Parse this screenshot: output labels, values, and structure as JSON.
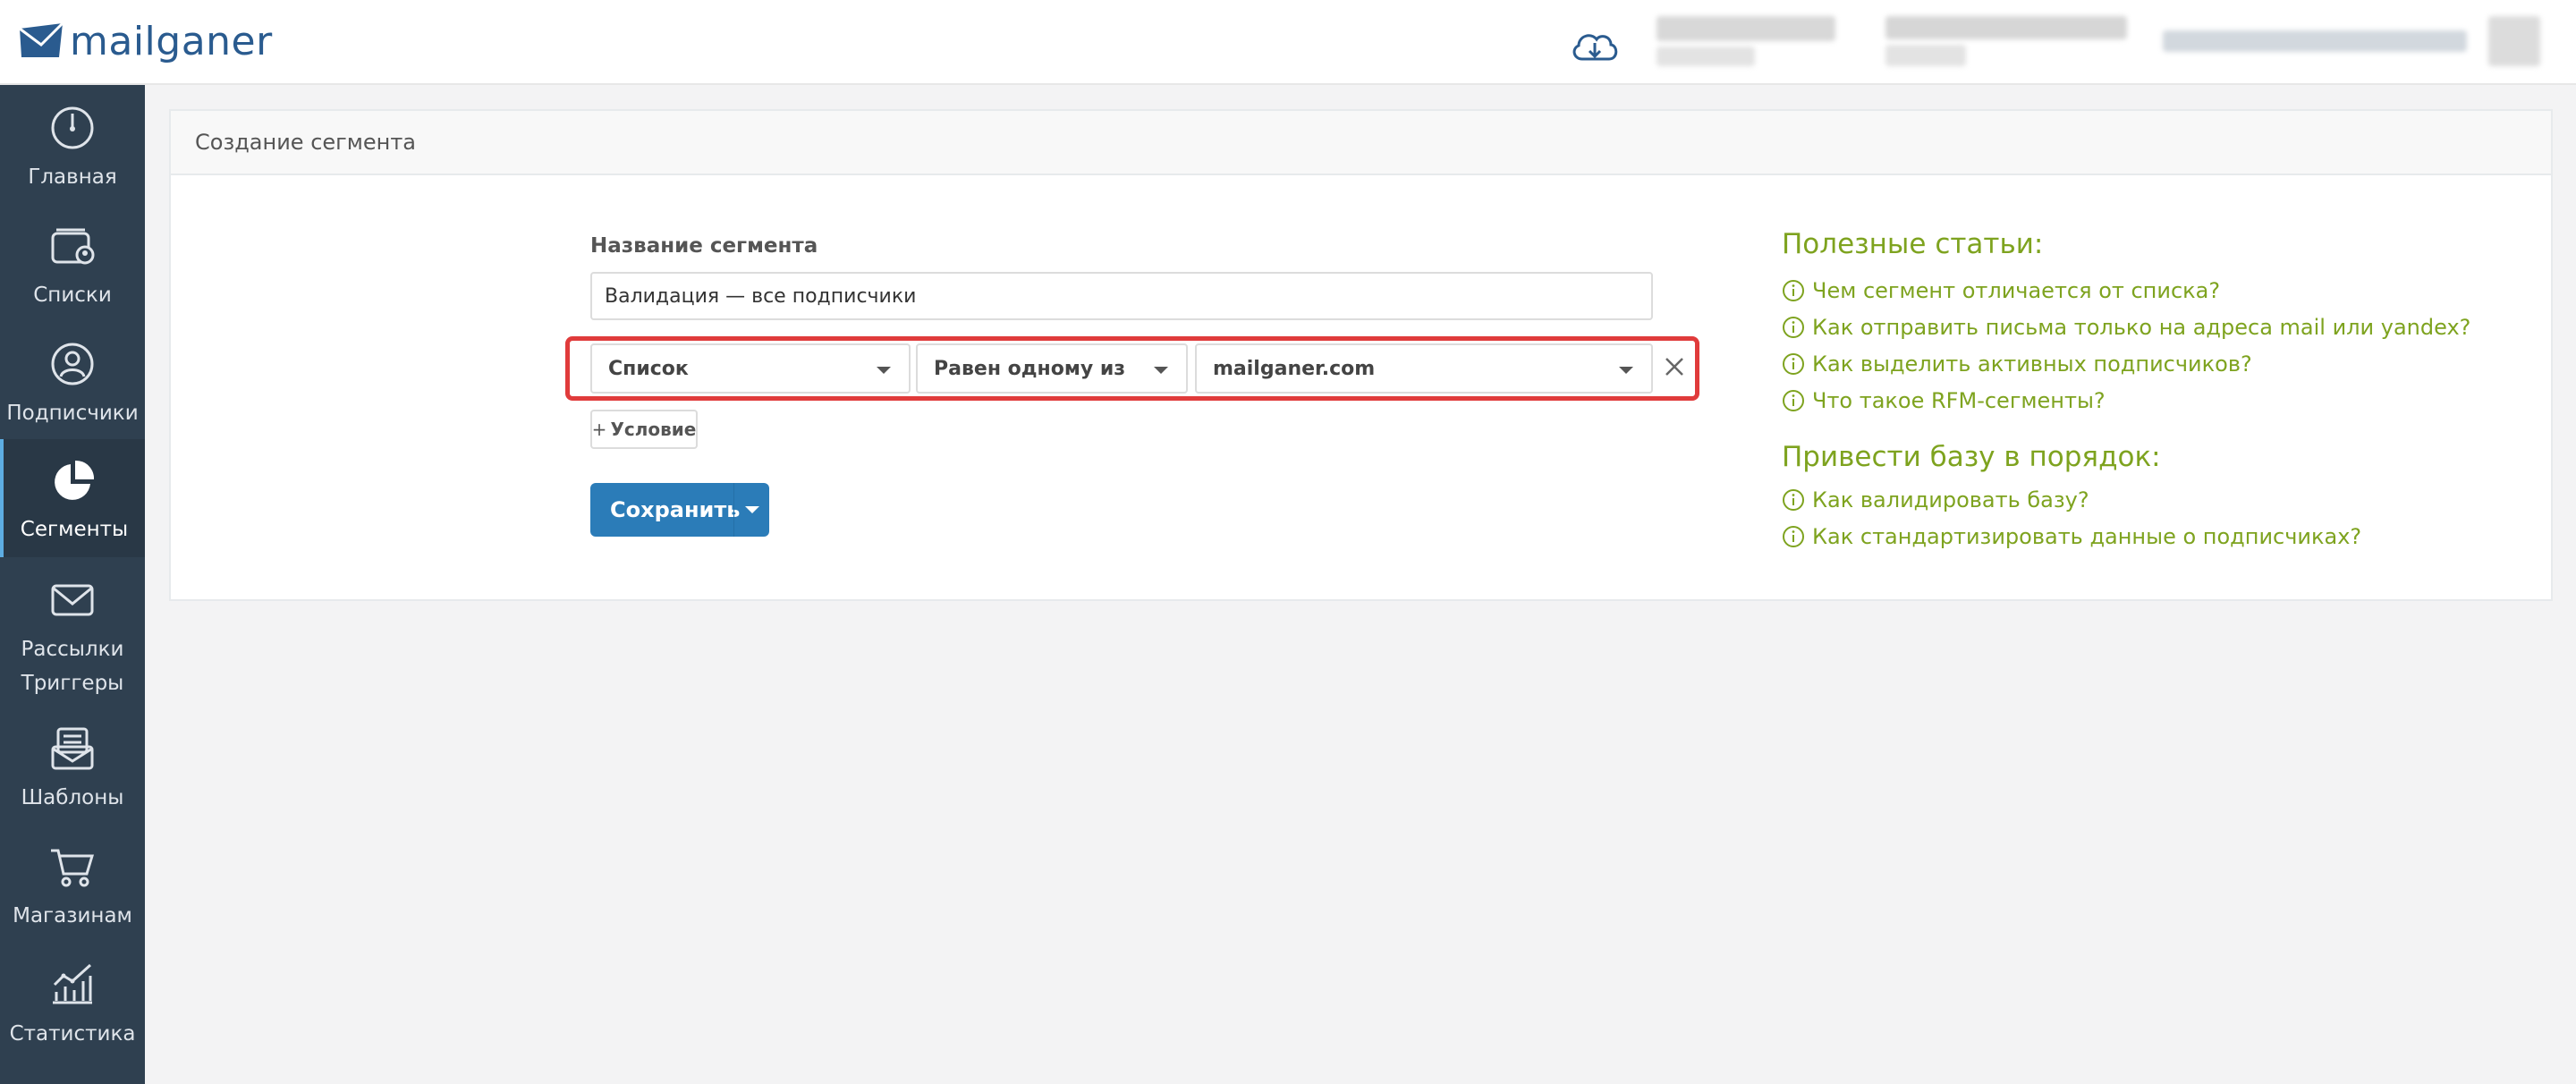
{
  "brand": {
    "name": "mailganer",
    "color": "#2a5b8f"
  },
  "header": {
    "cloud_icon": "cloud-download-icon",
    "user_info": "blurred"
  },
  "sidebar": {
    "items": [
      {
        "label": "Главная",
        "icon": "dashboard-icon"
      },
      {
        "label": "Списки",
        "icon": "lists-icon"
      },
      {
        "label": "Подписчики",
        "icon": "subscribers-icon"
      },
      {
        "label": "Сегменты",
        "icon": "segments-icon",
        "active": true
      },
      {
        "label": "Рассылки",
        "icon": "envelope-icon"
      },
      {
        "label": "Триггеры",
        "icon": "triggers-icon"
      },
      {
        "label": "Шаблоны",
        "icon": "templates-icon"
      },
      {
        "label": "Магазинам",
        "icon": "cart-icon"
      },
      {
        "label": "Статистика",
        "icon": "stats-icon"
      }
    ]
  },
  "panel": {
    "title": "Создание сегмента"
  },
  "form": {
    "name_label": "Название сегмента",
    "name_value": "Валидация — все подписчики",
    "condition": {
      "field": "Список",
      "operator": "Равен одному из",
      "value": "mailganer.com"
    },
    "add_condition_label": "Условие",
    "save_label": "Сохранить"
  },
  "help": {
    "useful_title": "Полезные статьи:",
    "useful_links": [
      "Чем сегмент отличается от списка?",
      "Как отправить письма только на адреса mail или yandex?",
      "Как выделить активных подписчиков?",
      "Что такое RFM-сегменты?"
    ],
    "cleanup_title": "Привести базу в порядок:",
    "cleanup_links": [
      "Как валидировать базу?",
      "Как стандартизировать данные о подписчиках?"
    ]
  },
  "colors": {
    "sidebar_bg": "#2f4050",
    "accent_green": "#7ea31f",
    "primary_button": "#2b7cb8",
    "highlight_border": "#e03b3b"
  }
}
